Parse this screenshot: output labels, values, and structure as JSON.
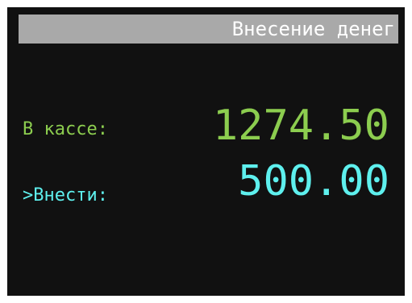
{
  "title": "Внесение денег",
  "cash": {
    "label": "В кассе:",
    "value": "1274.50"
  },
  "deposit": {
    "label": ">Внести:",
    "value": "500.00"
  },
  "colors": {
    "background": "#111111",
    "title_bar": "#a9a9a9",
    "title_text": "#ffffff",
    "cash": "#8ccd4f",
    "deposit": "#5ef0ee"
  }
}
